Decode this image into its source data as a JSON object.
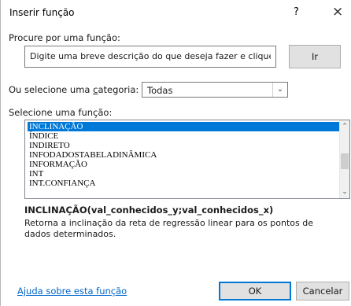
{
  "window": {
    "title": "Inserir função",
    "help_icon": "?",
    "close_icon": "×"
  },
  "search": {
    "label": "Procure por uma função:",
    "value": "Digite uma breve descrição do que deseja fazer e clique em 'Ir'",
    "button_label": "Ir"
  },
  "category": {
    "label_prefix": "Ou selecione uma ",
    "label_underlined": "c",
    "label_suffix": "ategoria:",
    "selected": "Todas"
  },
  "function_list": {
    "label": "Selecione uma função:",
    "items": [
      "INCLINAÇÃO",
      "ÍNDICE",
      "INDIRETO",
      "INFODADOSTABELADINÂMICA",
      "INFORMAÇÃO",
      "INT",
      "INT.CONFIANÇA"
    ],
    "selected_index": 0
  },
  "details": {
    "signature": "INCLINAÇÃO(val_conhecidos_y;val_conhecidos_x)",
    "description": "Retorna a inclinação da reta de regressão linear para os pontos de dados determinados."
  },
  "footer": {
    "help_link": "Ajuda sobre esta função",
    "ok_label": "OK",
    "cancel_label": "Cancelar"
  }
}
